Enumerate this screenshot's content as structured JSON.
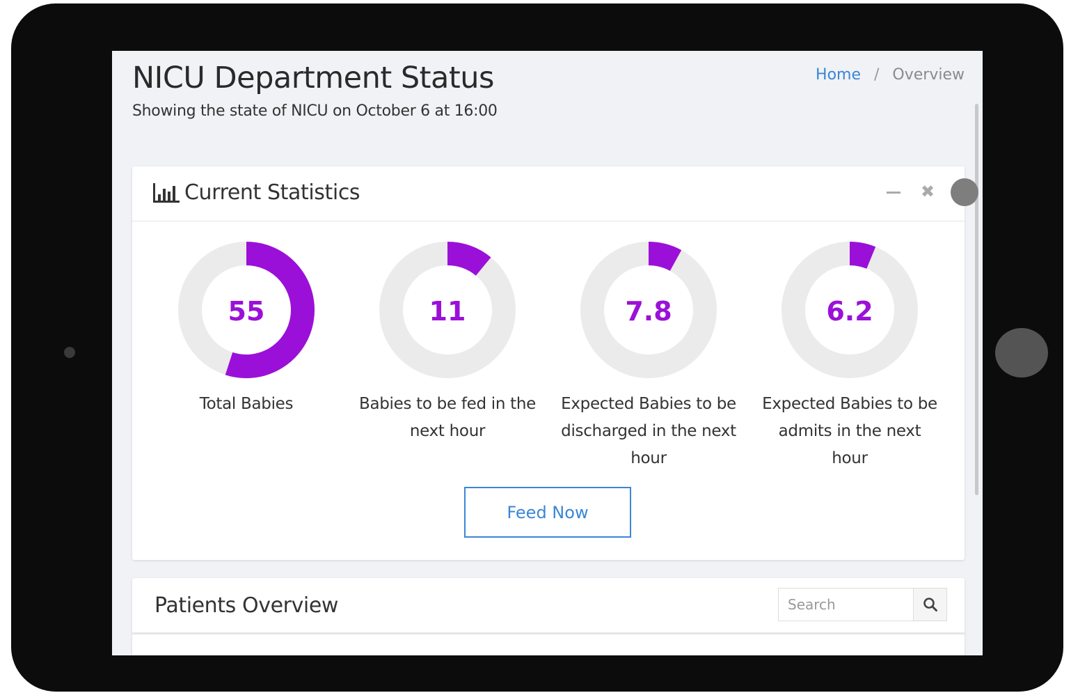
{
  "header": {
    "title": "NICU Department Status",
    "subtitle": "Showing the state of NICU on October 6 at 16:00"
  },
  "breadcrumb": {
    "home": "Home",
    "separator": "/",
    "current": "Overview"
  },
  "stats_card": {
    "title": "Current Statistics",
    "icon": "bar-chart-icon",
    "tools": {
      "minimize_icon": "minus-icon",
      "close_icon": "close-icon",
      "close_glyph": "✖"
    },
    "accent_color": "#9b10d8",
    "track_color": "#ebebeb",
    "stats": [
      {
        "value": "55",
        "label": "Total Babies",
        "fill": 0.55
      },
      {
        "value": "11",
        "label": "Babies to be fed in the next hour",
        "fill": 0.11
      },
      {
        "value": "7.8",
        "label": "Expected Babies to be discharged in the next hour",
        "fill": 0.08
      },
      {
        "value": "6.2",
        "label": "Expected Babies to be admits in the next hour",
        "fill": 0.062
      }
    ],
    "feed_button": "Feed Now"
  },
  "patients_card": {
    "title": "Patients Overview",
    "search_placeholder": "Search",
    "search_icon": "search-icon"
  }
}
